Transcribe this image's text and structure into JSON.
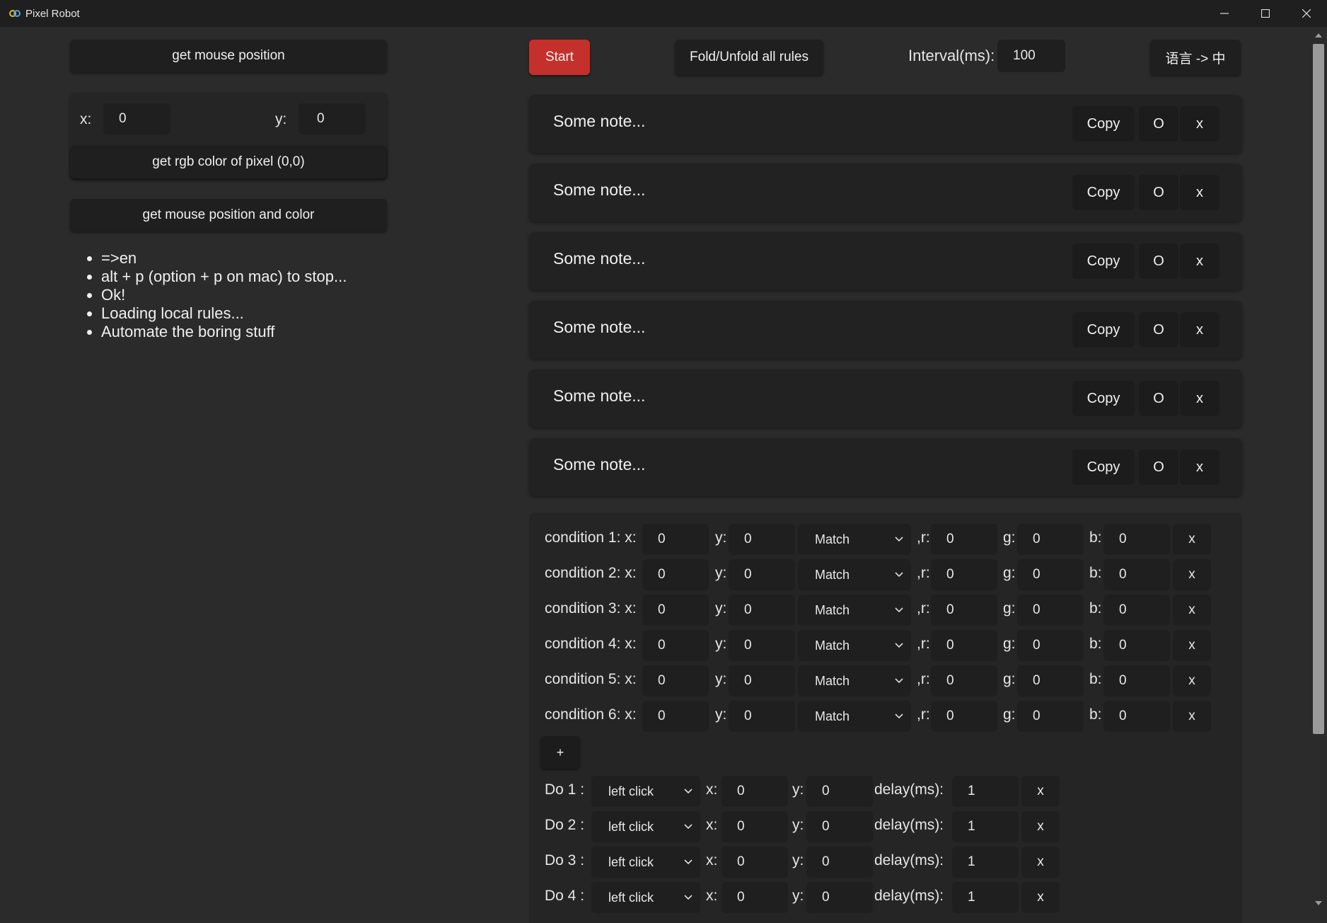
{
  "window": {
    "title": "Pixel Robot"
  },
  "left": {
    "get_mouse_position": "get mouse position",
    "x_label": "x:",
    "x_value": "0",
    "y_label": "y:",
    "y_value": "0",
    "get_rgb": "get rgb color of pixel (0,0)",
    "get_mouse_pos_color": "get mouse position and color",
    "messages": [
      "=>en",
      "alt + p (option + p on mac) to stop...",
      "Ok!",
      "Loading local rules...",
      "Automate the boring stuff"
    ]
  },
  "toolbar": {
    "start": "Start",
    "fold": "Fold/Unfold all rules",
    "interval_label": "Interval(ms):",
    "interval_value": "100",
    "language": "语言 -> 中",
    "start_color": "#c4302b"
  },
  "rules": [
    {
      "note": "Some note...",
      "copy": "Copy",
      "toggle": "O",
      "delete": "x"
    },
    {
      "note": "Some note...",
      "copy": "Copy",
      "toggle": "O",
      "delete": "x"
    },
    {
      "note": "Some note...",
      "copy": "Copy",
      "toggle": "O",
      "delete": "x"
    },
    {
      "note": "Some note...",
      "copy": "Copy",
      "toggle": "O",
      "delete": "x"
    },
    {
      "note": "Some note...",
      "copy": "Copy",
      "toggle": "O",
      "delete": "x"
    },
    {
      "note": "Some note...",
      "copy": "Copy",
      "toggle": "O",
      "delete": "x"
    }
  ],
  "conditions": [
    {
      "label": "condition 1: x:",
      "x": "0",
      "y_label": "y:",
      "y": "0",
      "mode": "Match",
      "r_label": ",r:",
      "r": "0",
      "g_label": "g:",
      "g": "0",
      "b_label": "b:",
      "b": "0",
      "delete": "x"
    },
    {
      "label": "condition 2: x:",
      "x": "0",
      "y_label": "y:",
      "y": "0",
      "mode": "Match",
      "r_label": ",r:",
      "r": "0",
      "g_label": "g:",
      "g": "0",
      "b_label": "b:",
      "b": "0",
      "delete": "x"
    },
    {
      "label": "condition 3: x:",
      "x": "0",
      "y_label": "y:",
      "y": "0",
      "mode": "Match",
      "r_label": ",r:",
      "r": "0",
      "g_label": "g:",
      "g": "0",
      "b_label": "b:",
      "b": "0",
      "delete": "x"
    },
    {
      "label": "condition 4: x:",
      "x": "0",
      "y_label": "y:",
      "y": "0",
      "mode": "Match",
      "r_label": ",r:",
      "r": "0",
      "g_label": "g:",
      "g": "0",
      "b_label": "b:",
      "b": "0",
      "delete": "x"
    },
    {
      "label": "condition 5: x:",
      "x": "0",
      "y_label": "y:",
      "y": "0",
      "mode": "Match",
      "r_label": ",r:",
      "r": "0",
      "g_label": "g:",
      "g": "0",
      "b_label": "b:",
      "b": "0",
      "delete": "x"
    },
    {
      "label": "condition 6: x:",
      "x": "0",
      "y_label": "y:",
      "y": "0",
      "mode": "Match",
      "r_label": ",r:",
      "r": "0",
      "g_label": "g:",
      "g": "0",
      "b_label": "b:",
      "b": "0",
      "delete": "x"
    }
  ],
  "add_condition": "+",
  "actions": [
    {
      "label": "Do 1 :",
      "action": "left click",
      "x_label": "x:",
      "x": "0",
      "y_label": "y:",
      "y": "0",
      "delay_label": "delay(ms):",
      "delay": "1",
      "delete": "x"
    },
    {
      "label": "Do 2 :",
      "action": "left click",
      "x_label": "x:",
      "x": "0",
      "y_label": "y:",
      "y": "0",
      "delay_label": "delay(ms):",
      "delay": "1",
      "delete": "x"
    },
    {
      "label": "Do 3 :",
      "action": "left click",
      "x_label": "x:",
      "x": "0",
      "y_label": "y:",
      "y": "0",
      "delay_label": "delay(ms):",
      "delay": "1",
      "delete": "x"
    },
    {
      "label": "Do 4 :",
      "action": "left click",
      "x_label": "x:",
      "x": "0",
      "y_label": "y:",
      "y": "0",
      "delay_label": "delay(ms):",
      "delay": "1",
      "delete": "x"
    }
  ]
}
